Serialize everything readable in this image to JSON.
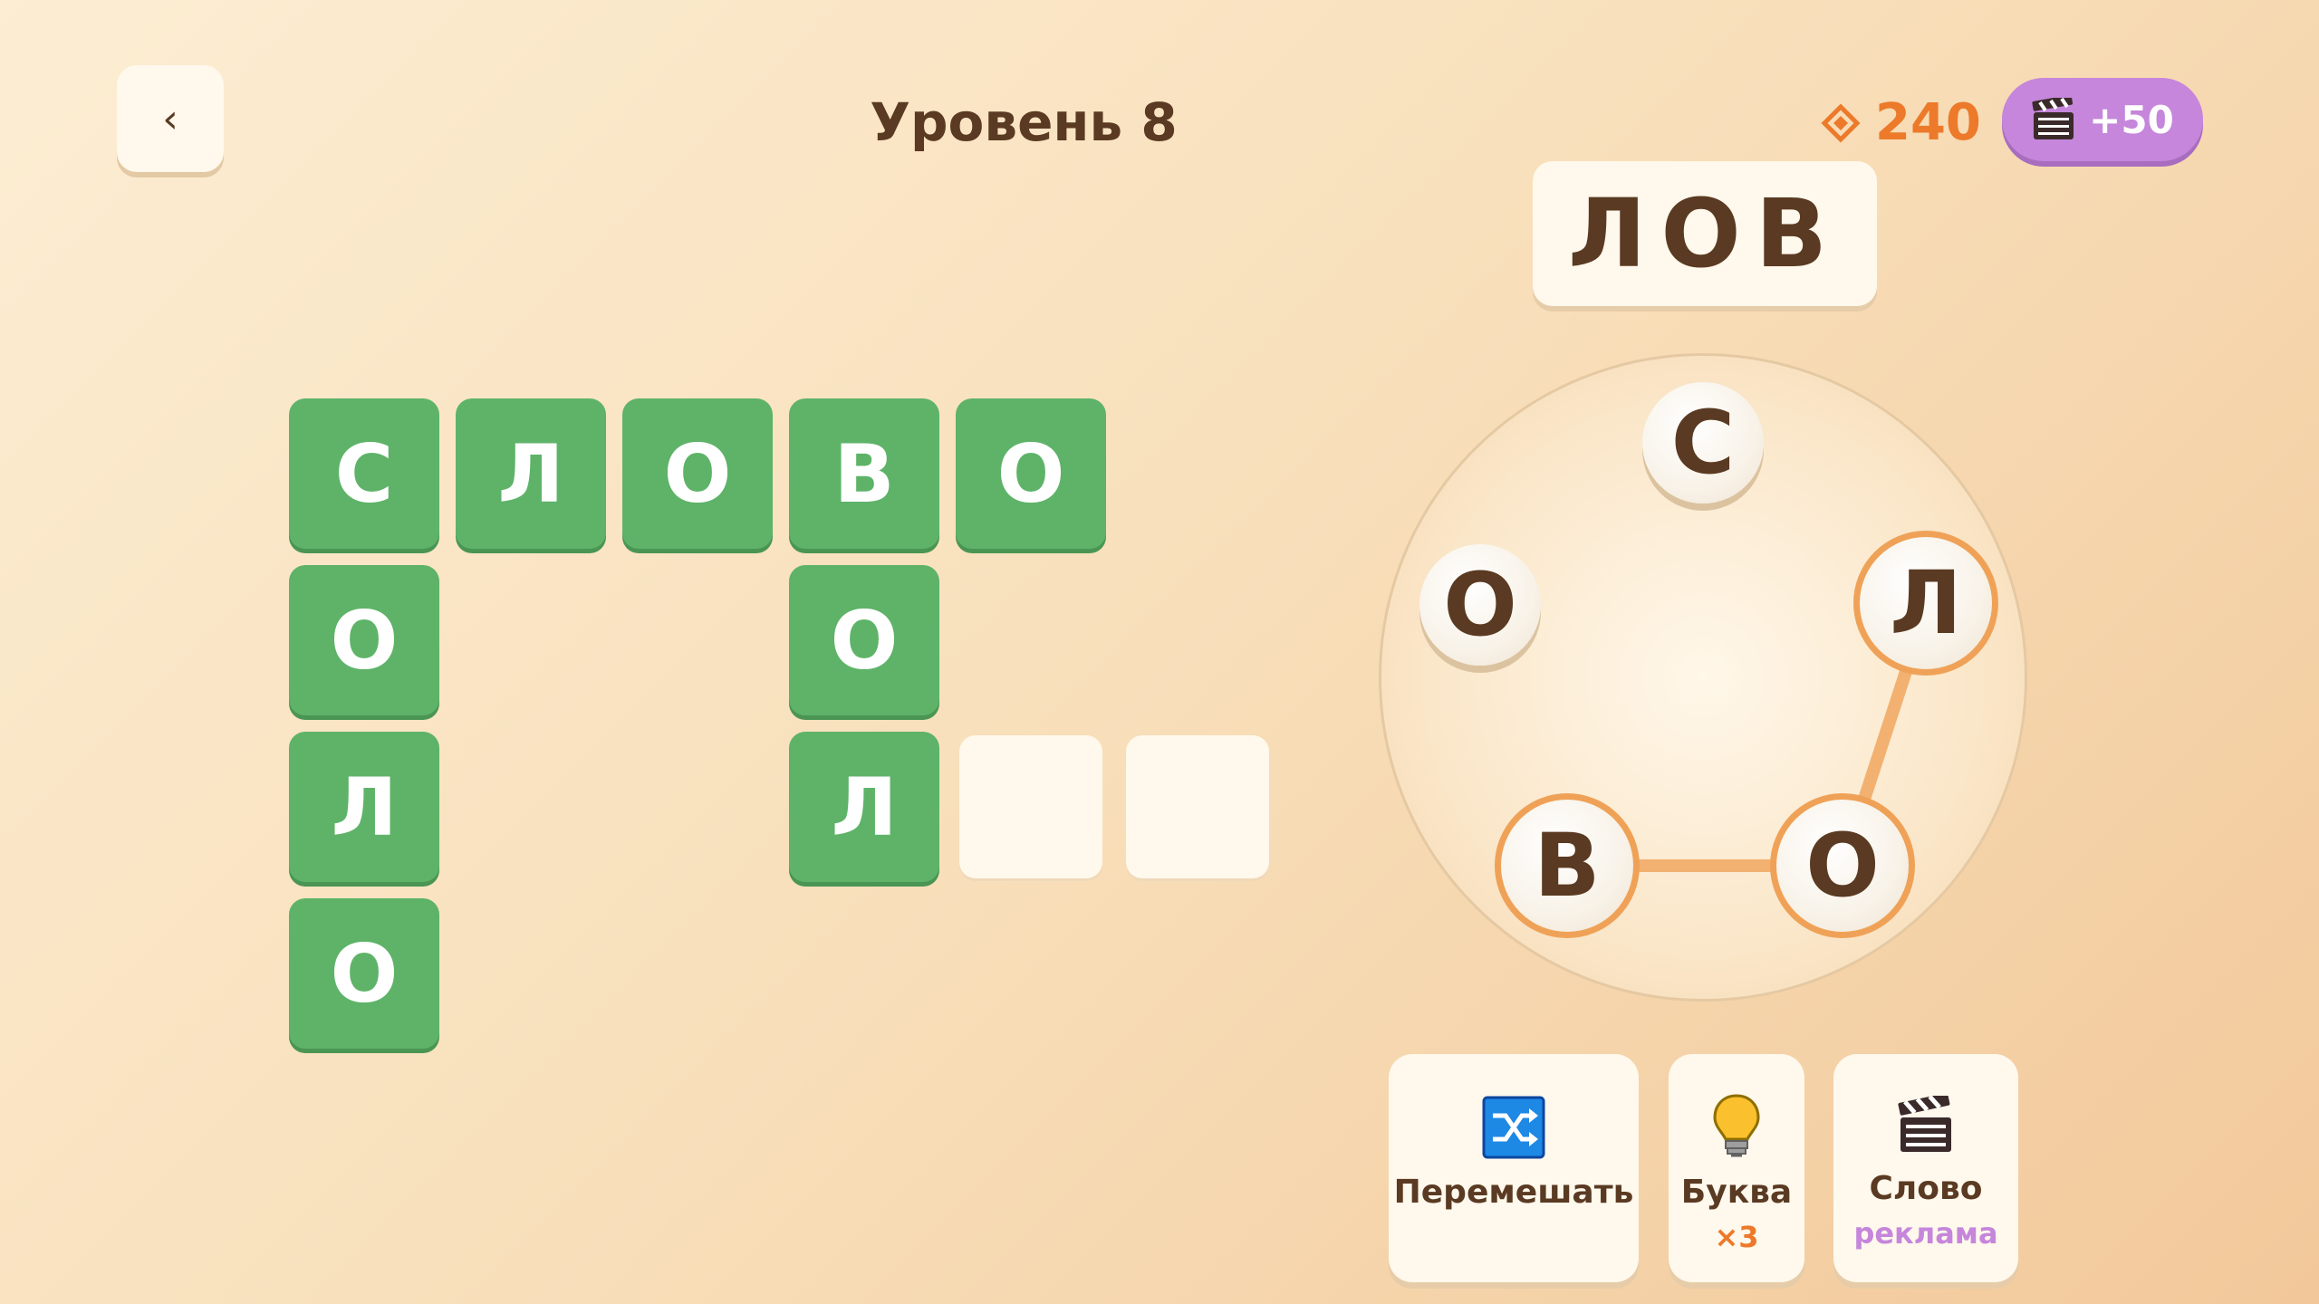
{
  "header": {
    "back_label": "‹",
    "level_title": "Уровень 8",
    "coins": "240",
    "ad_reward": "+50"
  },
  "current_word": "ЛОВ",
  "grid": {
    "words_found": [
      {
        "letters": [
          "С",
          "Л",
          "О",
          "В",
          "О"
        ]
      },
      {
        "letters": [
          "С",
          "О",
          "Л",
          "О"
        ]
      },
      {
        "letters": [
          "В",
          "О",
          "Л"
        ]
      }
    ],
    "empty_cells": 2
  },
  "wheel": {
    "letters": [
      "С",
      "Л",
      "О",
      "В",
      "О"
    ],
    "selected": [
      "Л",
      "О",
      "В"
    ]
  },
  "actions": {
    "shuffle": {
      "label": "Перемешать",
      "icon": "shuffle-icon"
    },
    "hint_letter": {
      "label": "Буква",
      "sub": "×3",
      "icon": "lightbulb-icon"
    },
    "hint_word": {
      "label": "Слово",
      "sub": "реклама",
      "icon": "clapperboard-icon"
    }
  },
  "colors": {
    "tile_green": "#5eb368",
    "accent_orange": "#ec7a2a",
    "ad_purple": "#c586db",
    "text_brown": "#5a3a22"
  }
}
